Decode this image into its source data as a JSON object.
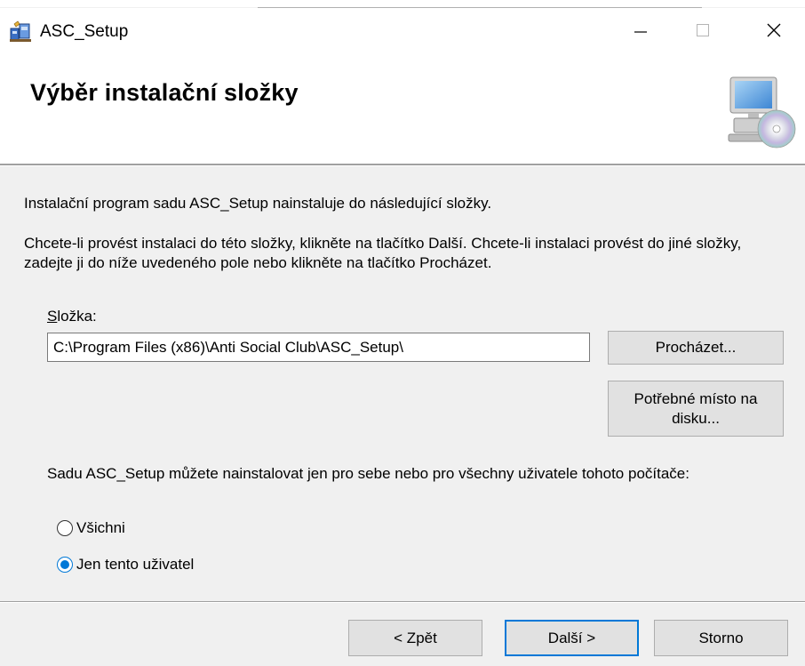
{
  "window": {
    "title": "ASC_Setup",
    "icon": "setup-package-icon",
    "controls": {
      "minimize": "minimize-icon",
      "maximize": "maximize-icon",
      "close": "close-icon"
    }
  },
  "banner": {
    "title": "Výběr instalační složky",
    "graphic": "computer-cd-icon"
  },
  "body": {
    "intro": "Instalační program sadu ASC_Setup nainstaluje do následující složky.",
    "instructions": "Chcete-li provést instalaci do této složky, klikněte na tlačítko Další. Chcete-li instalaci provést do jiné složky, zadejte ji do níže uvedeného pole nebo klikněte na tlačítko Procházet.",
    "folder_label_accel": "S",
    "folder_label_rest": "ložka:",
    "folder_value": "C:\\Program Files (x86)\\Anti Social Club\\ASC_Setup\\",
    "browse_button": "Procházet...",
    "disk_space_button": "Potřebné místo na disku...",
    "users_question": "Sadu ASC_Setup můžete nainstalovat jen pro sebe nebo pro všechny uživatele tohoto počítače:",
    "radio_all": "Všichni",
    "radio_me": "Jen tento uživatel",
    "selected_option": "Jen tento uživatel"
  },
  "footer": {
    "back_button": "< Zpět",
    "next_button": "Další >",
    "cancel_button": "Storno"
  },
  "colors": {
    "accent": "#0078d7",
    "dialog_bg": "#f0f0f0",
    "button_bg": "#e1e1e1"
  }
}
